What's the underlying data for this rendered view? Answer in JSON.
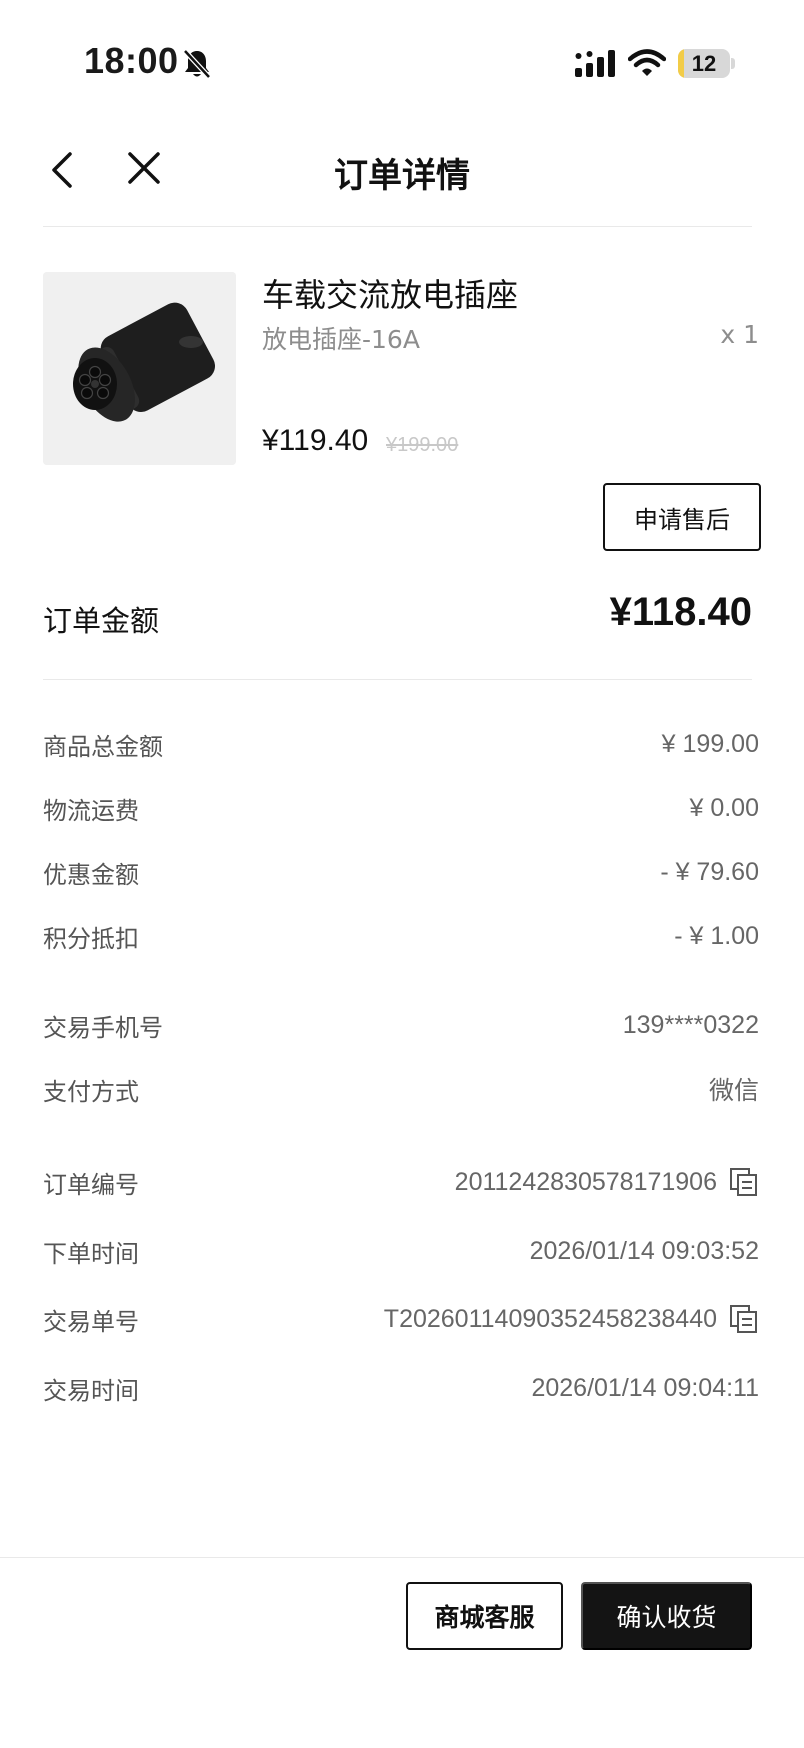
{
  "status_bar": {
    "time": "18:00",
    "battery_level": "12",
    "battery_fraction": 0.12,
    "icons": [
      "bell-muted-icon",
      "signal-icon",
      "wifi-icon",
      "battery-icon"
    ]
  },
  "nav": {
    "title": "订单详情",
    "icons": [
      "back-arrow-icon",
      "close-icon"
    ]
  },
  "product": {
    "name": "车载交流放电插座",
    "spec": "放电插座-16A",
    "quantity": "x 1",
    "price": "¥119.40",
    "original_price": "¥199.00",
    "aftersale_label": "申请售后"
  },
  "order_total": {
    "label": "订单金额",
    "value": "¥118.40"
  },
  "amounts": [
    {
      "label": "商品总金额",
      "value": "¥ 199.00"
    },
    {
      "label": "物流运费",
      "value": "¥ 0.00"
    },
    {
      "label": "优惠金额",
      "value": "- ¥ 79.60"
    },
    {
      "label": "积分抵扣",
      "value": "- ¥ 1.00"
    }
  ],
  "payment": [
    {
      "label": "交易手机号",
      "value": "139****0322"
    },
    {
      "label": "支付方式",
      "value": "微信"
    }
  ],
  "order_info": [
    {
      "label": "订单编号",
      "value": "2011242830578171906",
      "copyable": true
    },
    {
      "label": "下单时间",
      "value": "2026/01/14 09:03:52",
      "copyable": false
    },
    {
      "label": "交易单号",
      "value": "T20260114090352458238440",
      "copyable": true
    },
    {
      "label": "交易时间",
      "value": "2026/01/14 09:04:11",
      "copyable": false
    }
  ],
  "bottom_bar": {
    "service_label": "商城客服",
    "confirm_label": "确认收货"
  },
  "colors": {
    "primary_dark": "#141414",
    "muted_text": "#8d8d8d",
    "battery_yellow": "#f2cc47"
  }
}
